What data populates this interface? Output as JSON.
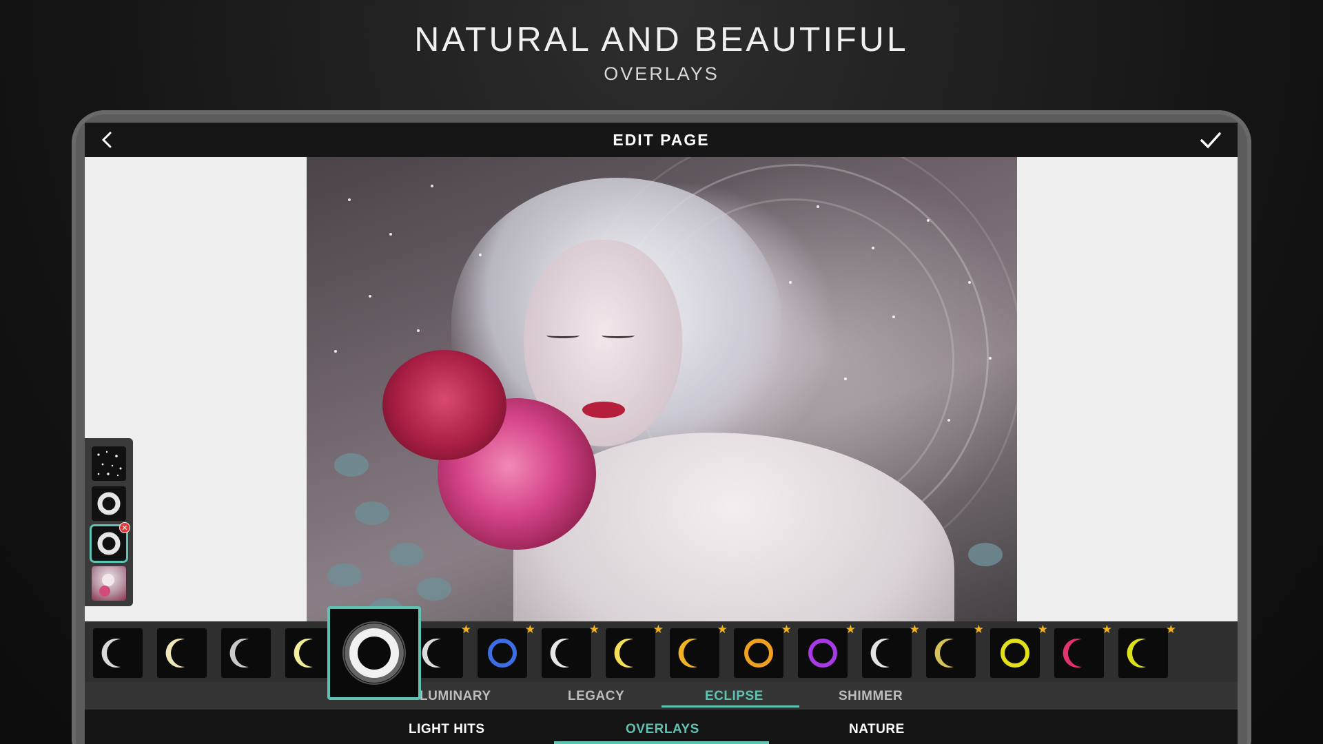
{
  "promo": {
    "headline": "NATURAL AND BEAUTIFUL",
    "subheadline": "OVERLAYS"
  },
  "topbar": {
    "title": "EDIT PAGE",
    "back_icon": "chevron-left-icon",
    "confirm_icon": "checkmark-icon"
  },
  "layers": [
    {
      "name": "sparkle-overlay-layer",
      "icon": "sparkle-icon",
      "selected": false
    },
    {
      "name": "eclipse-overlay-layer",
      "icon": "eclipse-ring-icon",
      "selected": false
    },
    {
      "name": "eclipse-overlay-layer-active",
      "icon": "eclipse-ring-icon",
      "selected": true,
      "remove_icon": "remove-icon"
    },
    {
      "name": "photo-layer",
      "icon": "photo-icon",
      "selected": false
    }
  ],
  "effects": [
    {
      "icon": "crescent-white-icon",
      "color": "#d9d9d9",
      "premium": false
    },
    {
      "icon": "crescent-cream-icon",
      "color": "#efe7b8",
      "premium": false
    },
    {
      "icon": "crescent-silver-icon",
      "color": "#c9c9c9",
      "premium": false
    },
    {
      "icon": "crescent-yellow-icon",
      "color": "#f2ee9a",
      "premium": false
    },
    {
      "icon": "crescent-amber-icon",
      "color": "#f0a23a",
      "premium": true
    },
    {
      "icon": "crescent-pale-icon",
      "color": "#dcdcdc",
      "premium": true
    },
    {
      "icon": "ring-blue-icon",
      "color": "#3d6ee6",
      "premium": true
    },
    {
      "icon": "wisp-white-icon",
      "color": "#e6e6e6",
      "premium": true
    },
    {
      "icon": "crescent-gold-icon",
      "color": "#f5df58",
      "premium": true
    },
    {
      "icon": "crescent-orange-icon",
      "color": "#f2b322",
      "premium": true
    },
    {
      "icon": "ring-fire-icon",
      "color": "#f0a021",
      "premium": true
    },
    {
      "icon": "ring-purple-icon",
      "color": "#a63ae6",
      "premium": true
    },
    {
      "icon": "crescent-moon-icon",
      "color": "#e3e3e3",
      "premium": true
    },
    {
      "icon": "crescent-glitter-icon",
      "color": "#d6c25a",
      "premium": true
    },
    {
      "icon": "ring-yellow-icon",
      "color": "#e2e019",
      "premium": true
    },
    {
      "icon": "crescent-pink-icon",
      "color": "#e2336e",
      "premium": true
    },
    {
      "icon": "crescent-lime-icon",
      "color": "#dbe21c",
      "premium": true
    }
  ],
  "selected_effect": {
    "icon": "eclipse-swirl-icon"
  },
  "subtabs": [
    {
      "label": "LUMINARY",
      "active": false
    },
    {
      "label": "LEGACY",
      "active": false
    },
    {
      "label": "ECLIPSE",
      "active": true
    },
    {
      "label": "SHIMMER",
      "active": false
    }
  ],
  "maintabs": [
    {
      "label": "LIGHT HITS",
      "active": false
    },
    {
      "label": "OVERLAYS",
      "active": true
    },
    {
      "label": "NATURE",
      "active": false
    }
  ],
  "colors": {
    "accent": "#5fc3b4",
    "premium_star": "#f6b21b",
    "background": "#161616"
  }
}
